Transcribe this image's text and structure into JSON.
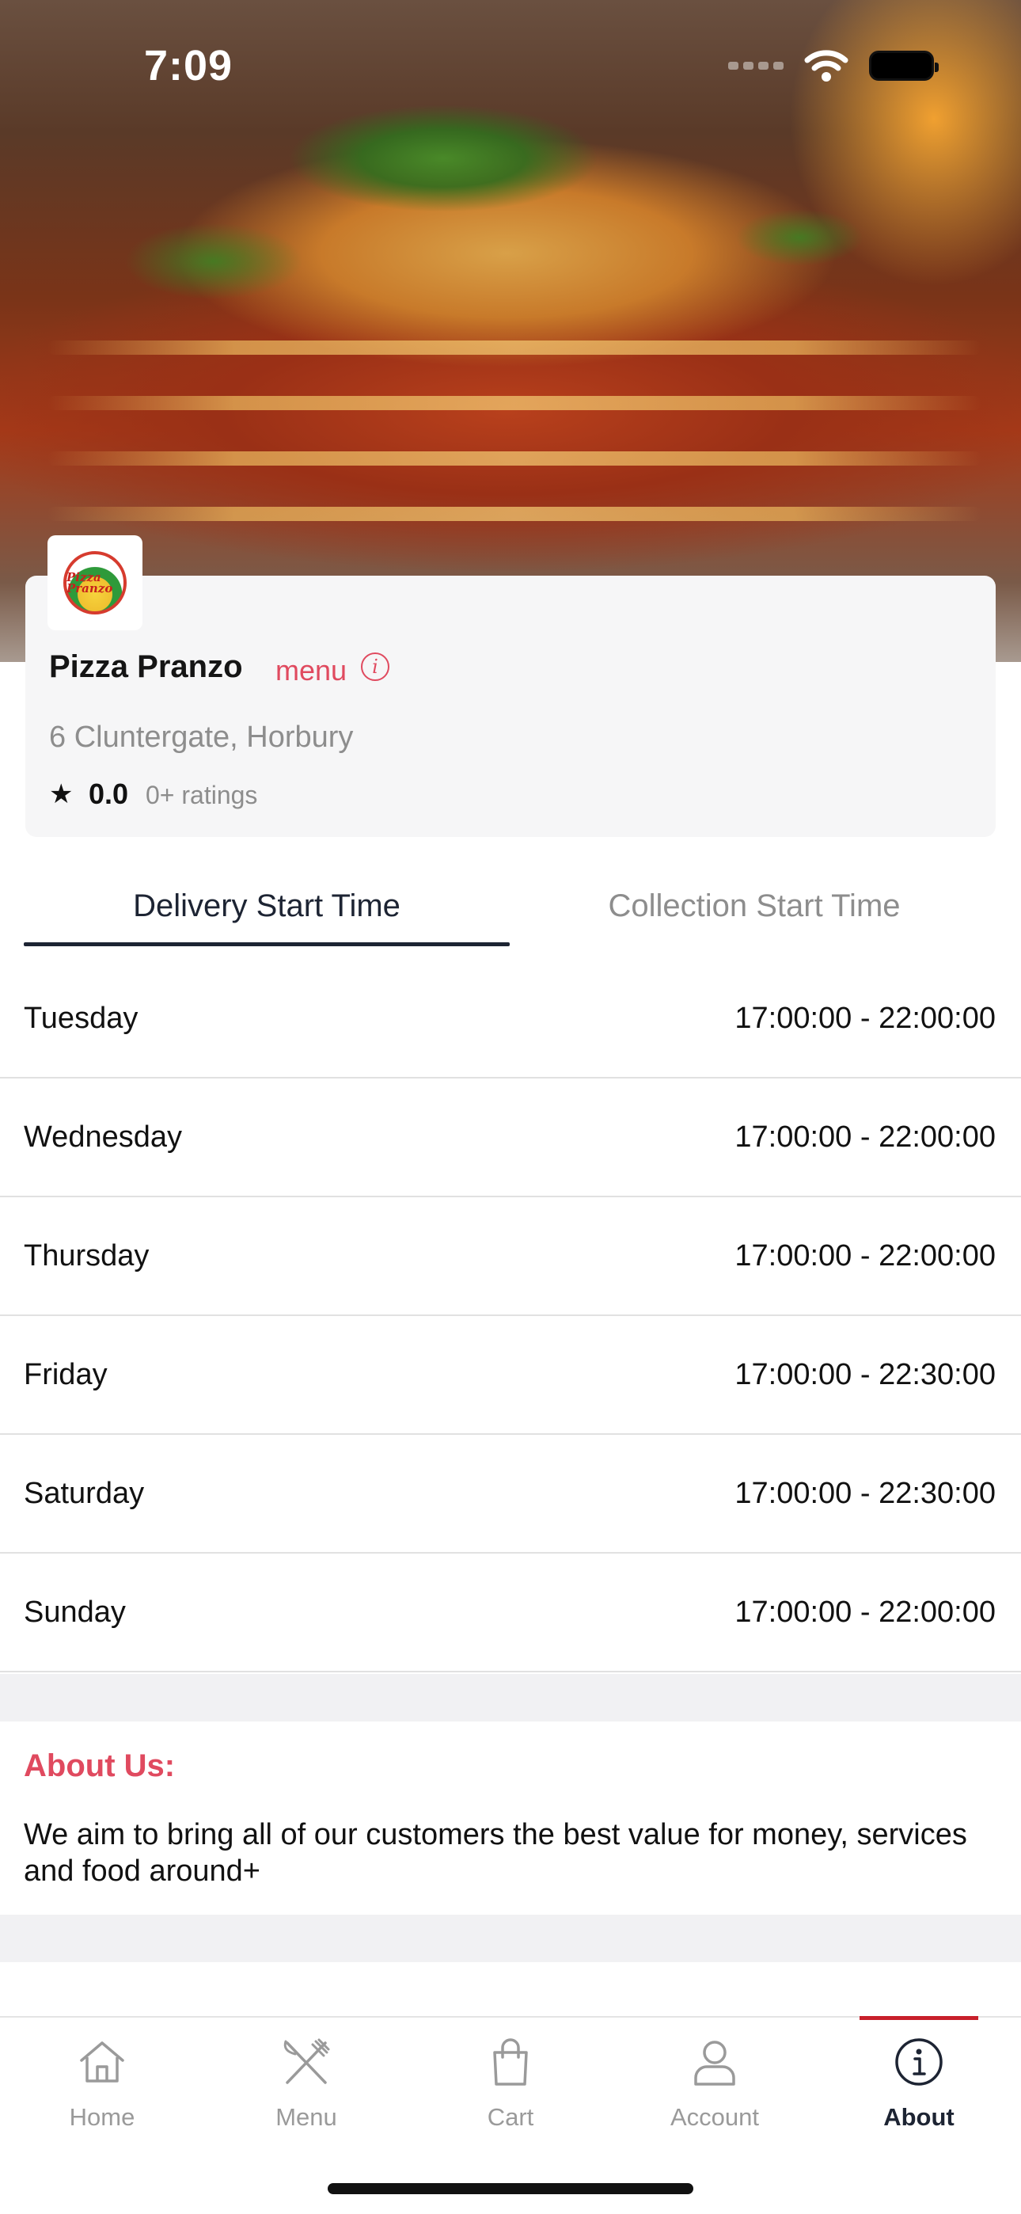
{
  "status_bar": {
    "time": "7:09"
  },
  "restaurant": {
    "logo_text": "Pizza Pranzo",
    "name": "Pizza Pranzo",
    "menu_link": "menu",
    "address": "6 Cluntergate, Horbury",
    "rating": "0.0",
    "rating_count": "0+ ratings"
  },
  "tabs": {
    "delivery": "Delivery Start Time",
    "collection": "Collection Start Time",
    "active": "delivery"
  },
  "hours": [
    {
      "day": "Tuesday",
      "time": "17:00:00 - 22:00:00"
    },
    {
      "day": "Wednesday",
      "time": "17:00:00 - 22:00:00"
    },
    {
      "day": "Thursday",
      "time": "17:00:00 - 22:00:00"
    },
    {
      "day": "Friday",
      "time": "17:00:00 - 22:30:00"
    },
    {
      "day": "Saturday",
      "time": "17:00:00 - 22:30:00"
    },
    {
      "day": "Sunday",
      "time": "17:00:00 - 22:00:00"
    }
  ],
  "about": {
    "title": "About Us:",
    "text": "We aim to bring all of our customers the best value for money, services and food around+"
  },
  "nav": {
    "items": [
      {
        "label": "Home",
        "icon": "home-icon"
      },
      {
        "label": "Menu",
        "icon": "fork-knife-icon"
      },
      {
        "label": "Cart",
        "icon": "shopping-bag-icon"
      },
      {
        "label": "Account",
        "icon": "person-icon"
      },
      {
        "label": "About",
        "icon": "info-icon"
      }
    ],
    "active": "About"
  },
  "colors": {
    "accent": "#e04a5f",
    "active_tab": "#1d2433",
    "nav_indicator": "#c8202b"
  }
}
